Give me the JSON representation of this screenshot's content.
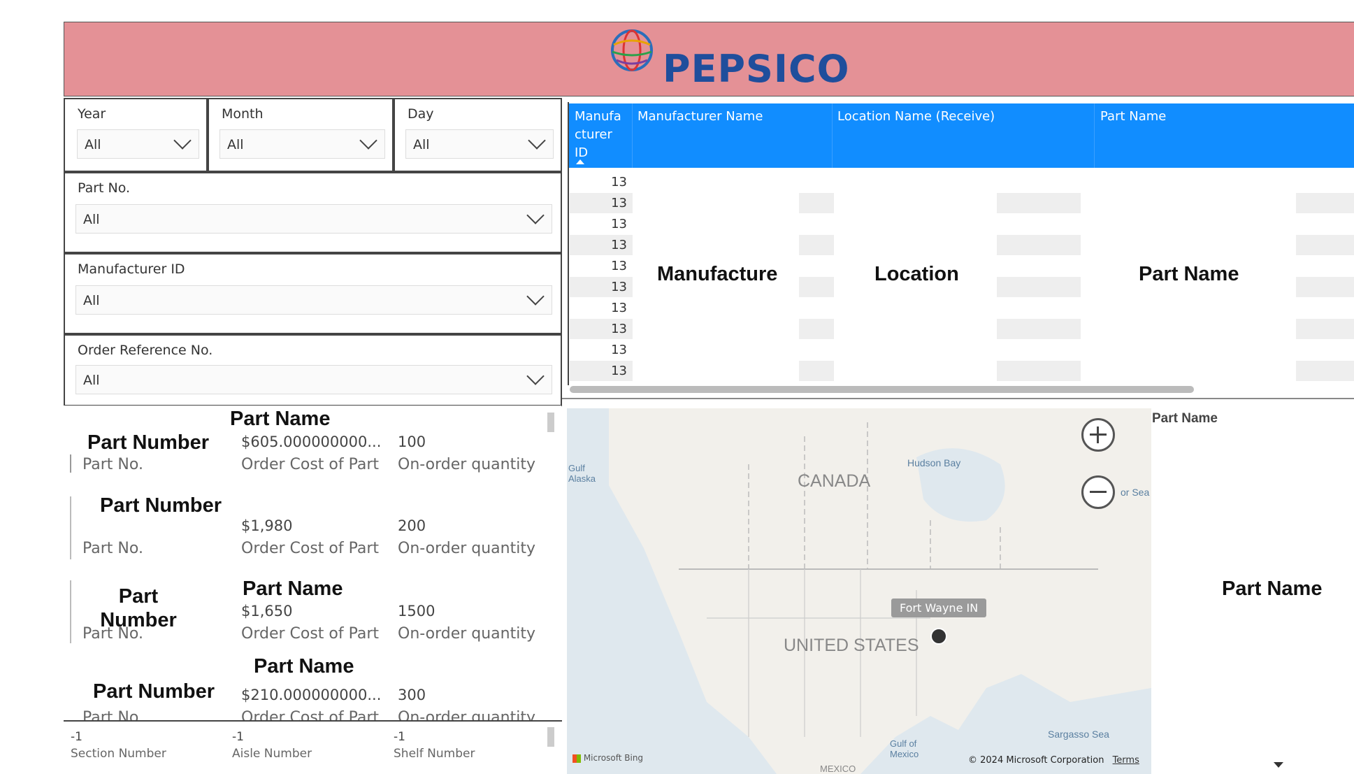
{
  "header": {
    "brand": "PEPSICO"
  },
  "slicers": {
    "year": {
      "label": "Year",
      "value": "All"
    },
    "month": {
      "label": "Month",
      "value": "All"
    },
    "day": {
      "label": "Day",
      "value": "All"
    },
    "part_no": {
      "label": "Part No.",
      "value": "All"
    },
    "manufacturer_id": {
      "label": "Manufacturer ID",
      "value": "All"
    },
    "order_ref": {
      "label": "Order Reference No.",
      "value": "All"
    }
  },
  "table": {
    "columns": [
      "Manufa\ncturer\nID",
      "Manufacturer Name",
      "Location Name (Receive)",
      "Part Name"
    ],
    "ids": [
      "13",
      "13",
      "13",
      "13",
      "13",
      "13",
      "13",
      "13",
      "13",
      "13"
    ],
    "overlays": [
      "Manufacture",
      "Location",
      "Part Name"
    ]
  },
  "cards": [
    {
      "title": "Part Name",
      "part_label_bold": "Part Number",
      "part_no_label": "Part No.",
      "cost": "$605.000000000...",
      "cost_label": "Order Cost of Part",
      "qty": "100",
      "qty_label": "On-order quantity"
    },
    {
      "title": "",
      "part_label_bold": "Part Number",
      "part_no_label": "Part No.",
      "cost": "$1,980",
      "cost_label": "Order Cost of Part",
      "qty": "200",
      "qty_label": "On-order quantity"
    },
    {
      "title": "Part Name",
      "part_label_bold": "Part\nNumber",
      "part_no_label": "Part No.",
      "cost": "$1,650",
      "cost_label": "Order Cost of Part",
      "qty": "1500",
      "qty_label": "On-order quantity"
    },
    {
      "title": "Part Name",
      "part_label_bold": "Part Number",
      "part_no_label": "Part No.",
      "cost": "$210.000000000...",
      "cost_label": "Order Cost of Part",
      "qty": "300",
      "qty_label": "On-order quantity"
    }
  ],
  "location_bar": {
    "section": {
      "value": "-1",
      "label": "Section Number"
    },
    "aisle": {
      "value": "-1",
      "label": "Aisle Number"
    },
    "shelf": {
      "value": "-1",
      "label": "Shelf Number"
    }
  },
  "map": {
    "labels": {
      "canada": "CANADA",
      "usa": "UNITED STATES",
      "hudson": "Hudson Bay",
      "gulf_alaska": "Gulf\nAlaska",
      "sargasso": "Sargasso Sea",
      "gulf_mexico": "Gulf of\nMexico",
      "mexico": "MEXICO",
      "sea": "or Sea"
    },
    "tooltip": "Fort Wayne IN",
    "copyright": "© 2024 Microsoft Corporation",
    "terms": "Terms",
    "bing": "Microsoft Bing"
  },
  "right_panel": {
    "header": "Part Name",
    "overlay": "Part Name"
  }
}
